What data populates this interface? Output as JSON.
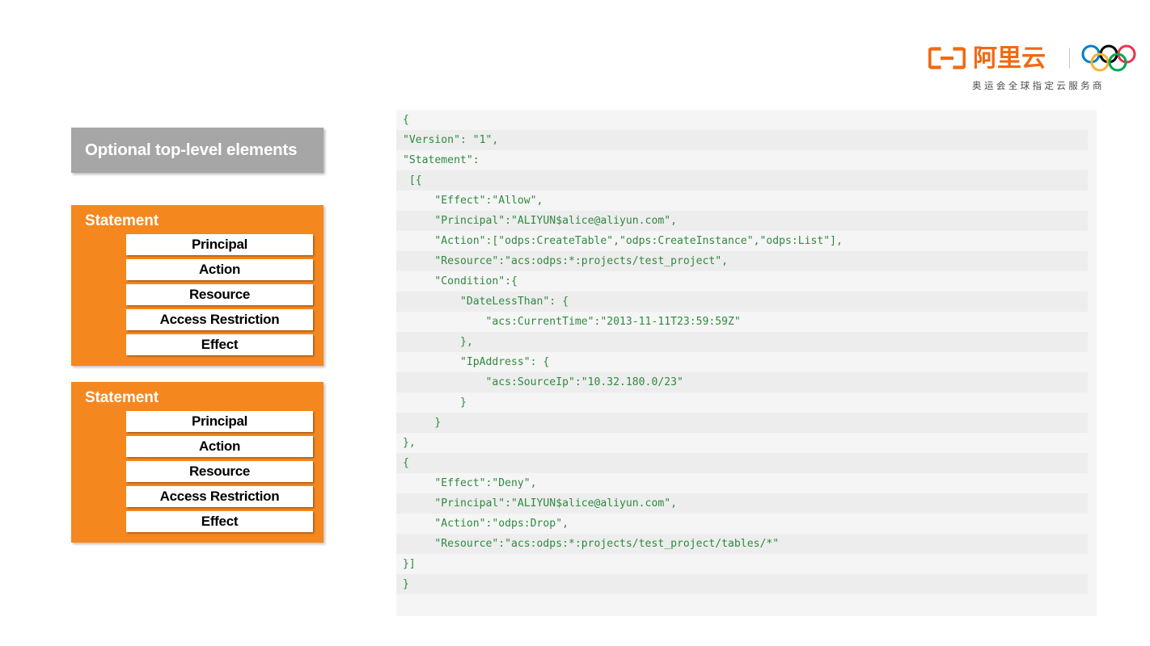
{
  "brand": {
    "logo_mark_name": "alibaba-cloud-logo-mark",
    "logo_wordmark": "阿里云",
    "rings_name": "olympic-rings-icon",
    "tagline": "奥运会全球指定云服务商",
    "orange": "#f06a12",
    "ring_colors": [
      "#0081c8",
      "#000000",
      "#ee334e",
      "#fcb131",
      "#00a651"
    ]
  },
  "diagram": {
    "top_box": {
      "label": "Optional top-level elements",
      "bg": "#a6a6a6",
      "text_color": "#ffffff"
    },
    "statement_bg": "#f5871f",
    "statements": [
      {
        "title": "Statement",
        "rows": [
          "Principal",
          "Action",
          "Resource",
          "Access Restriction",
          "Effect"
        ]
      },
      {
        "title": "Statement",
        "rows": [
          "Principal",
          "Action",
          "Resource",
          "Access Restriction",
          "Effect"
        ]
      }
    ]
  },
  "code_panel": {
    "text_color": "#2f8a3f",
    "stripe_colors": [
      "#f5f5f5",
      "#ededed"
    ],
    "lines": [
      "{",
      "\"Version\": \"1\",",
      "\"Statement\":",
      " [{",
      "     \"Effect\":\"Allow\",",
      "     \"Principal\":\"ALIYUN$alice@aliyun.com\",",
      "     \"Action\":[\"odps:CreateTable\",\"odps:CreateInstance\",\"odps:List\"],",
      "     \"Resource\":\"acs:odps:*:projects/test_project\",",
      "     \"Condition\":{",
      "         \"DateLessThan\": {",
      "             \"acs:CurrentTime\":\"2013-11-11T23:59:59Z\"",
      "         },",
      "         \"IpAddress\": {",
      "             \"acs:SourceIp\":\"10.32.180.0/23\"",
      "         }",
      "     }",
      "},",
      "{",
      "     \"Effect\":\"Deny\",",
      "     \"Principal\":\"ALIYUN$alice@aliyun.com\",",
      "     \"Action\":\"odps:Drop\",",
      "     \"Resource\":\"acs:odps:*:projects/test_project/tables/*\"",
      "}]",
      "}",
      ""
    ]
  }
}
